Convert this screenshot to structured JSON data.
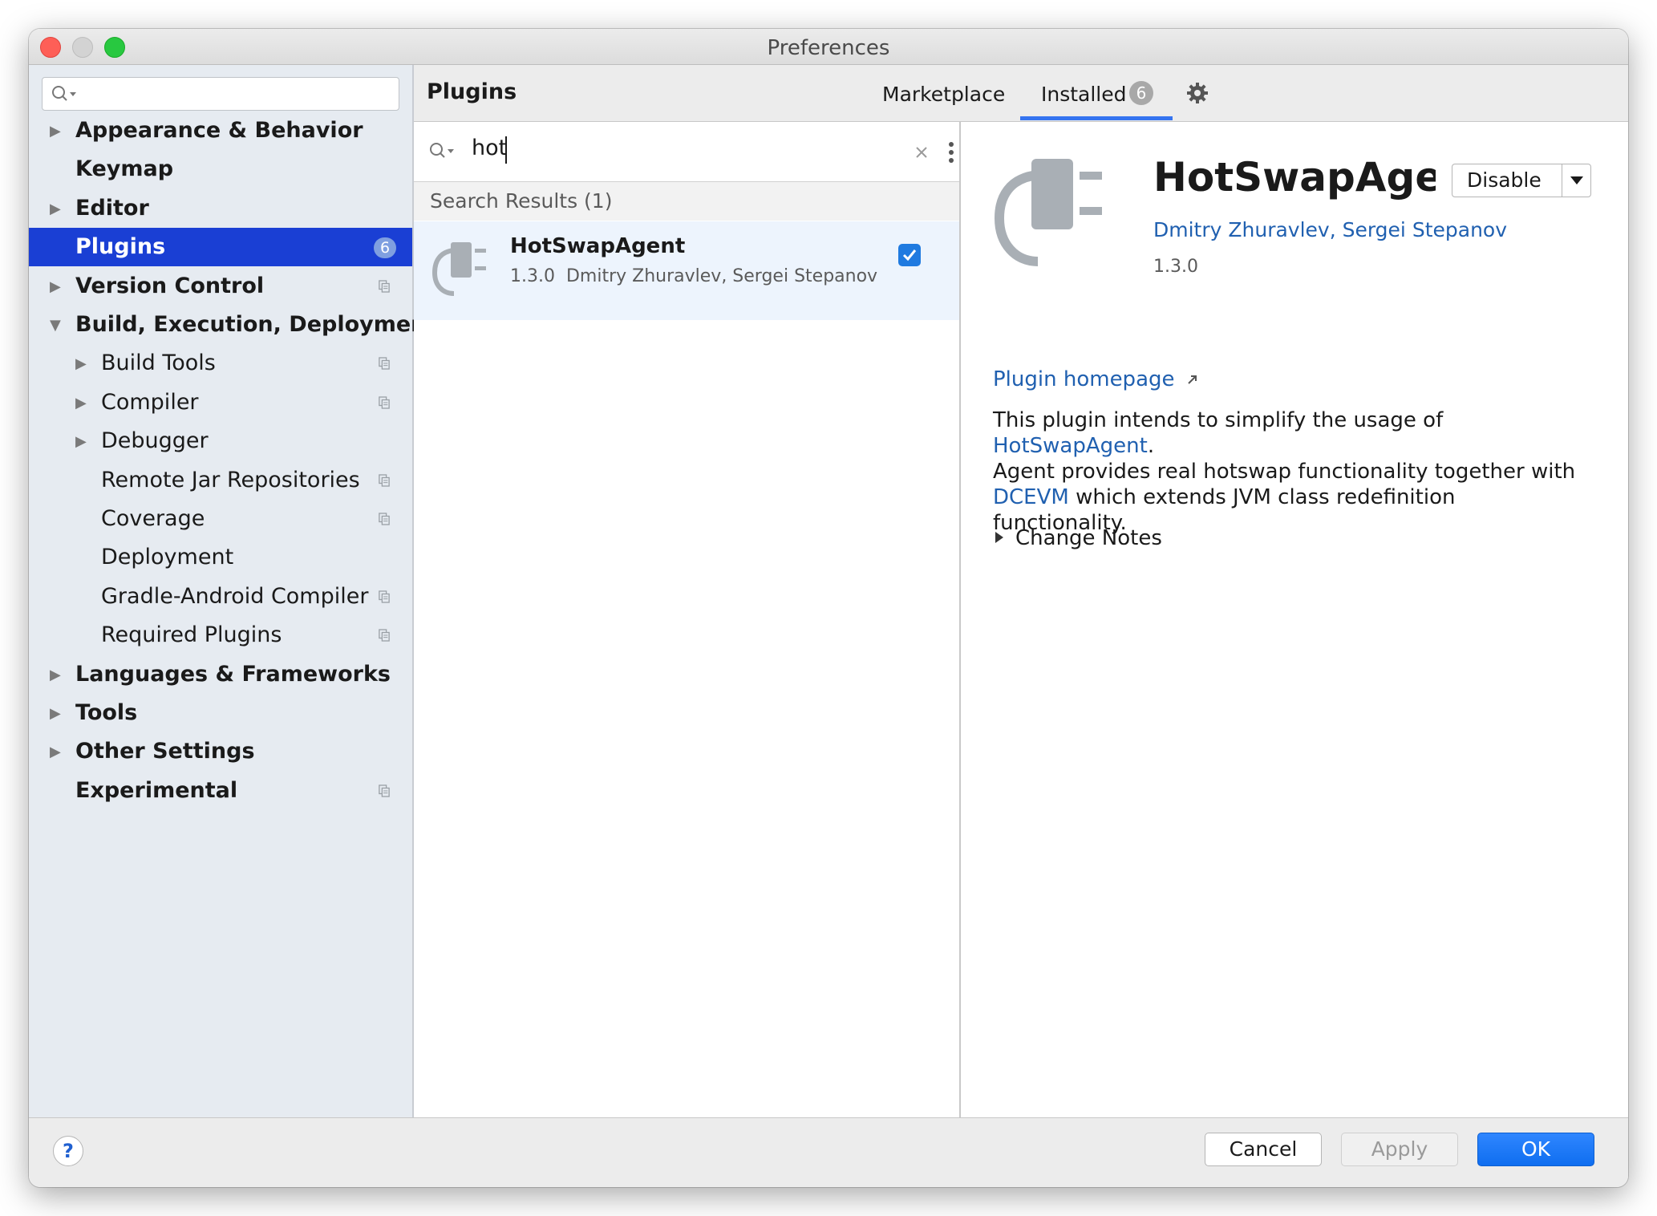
{
  "window": {
    "title": "Preferences",
    "traffic_colors": {
      "close": "#fe5f57",
      "minimize": "#d3d3d3",
      "zoom": "#28c840"
    }
  },
  "sidebar": {
    "search_placeholder": "",
    "items": [
      {
        "label": "Appearance & Behavior",
        "level": 0,
        "bold": true,
        "arrow": "collapsed",
        "project_icon": false
      },
      {
        "label": "Keymap",
        "level": 0,
        "bold": true,
        "arrow": "none",
        "project_icon": false
      },
      {
        "label": "Editor",
        "level": 0,
        "bold": true,
        "arrow": "collapsed",
        "project_icon": false
      },
      {
        "label": "Plugins",
        "level": 0,
        "bold": true,
        "arrow": "none",
        "selected": true,
        "badge": "6"
      },
      {
        "label": "Version Control",
        "level": 0,
        "bold": true,
        "arrow": "collapsed",
        "project_icon": true
      },
      {
        "label": "Build, Execution, Deployment",
        "level": 0,
        "bold": true,
        "arrow": "expanded",
        "project_icon": false
      },
      {
        "label": "Build Tools",
        "level": 1,
        "bold": false,
        "arrow": "collapsed",
        "project_icon": true
      },
      {
        "label": "Compiler",
        "level": 1,
        "bold": false,
        "arrow": "collapsed",
        "project_icon": true
      },
      {
        "label": "Debugger",
        "level": 1,
        "bold": false,
        "arrow": "collapsed",
        "project_icon": false
      },
      {
        "label": "Remote Jar Repositories",
        "level": 1,
        "bold": false,
        "arrow": "none",
        "project_icon": true
      },
      {
        "label": "Coverage",
        "level": 1,
        "bold": false,
        "arrow": "none",
        "project_icon": true
      },
      {
        "label": "Deployment",
        "level": 1,
        "bold": false,
        "arrow": "none",
        "project_icon": false
      },
      {
        "label": "Gradle-Android Compiler",
        "level": 1,
        "bold": false,
        "arrow": "none",
        "project_icon": true
      },
      {
        "label": "Required Plugins",
        "level": 1,
        "bold": false,
        "arrow": "none",
        "project_icon": true
      },
      {
        "label": "Languages & Frameworks",
        "level": 0,
        "bold": true,
        "arrow": "collapsed",
        "project_icon": false
      },
      {
        "label": "Tools",
        "level": 0,
        "bold": true,
        "arrow": "collapsed",
        "project_icon": false
      },
      {
        "label": "Other Settings",
        "level": 0,
        "bold": true,
        "arrow": "collapsed",
        "project_icon": false
      },
      {
        "label": "Experimental",
        "level": 0,
        "bold": true,
        "arrow": "none",
        "project_icon": true
      }
    ]
  },
  "plugins": {
    "title": "Plugins",
    "tabs": {
      "marketplace": "Marketplace",
      "installed": "Installed",
      "installed_count": "6"
    },
    "search_query": "hot",
    "results_header": "Search Results (1)",
    "results": [
      {
        "name": "HotSwapAgent",
        "version": "1.3.0",
        "authors": "Dmitry Zhuravlev, Sergei Stepanov",
        "enabled": true
      }
    ]
  },
  "detail": {
    "name": "HotSwapAgent",
    "authors": "Dmitry Zhuravlev, Sergei Stepanov",
    "version": "1.3.0",
    "disable_label": "Disable",
    "homepage_label": "Plugin homepage",
    "description": {
      "line1": "This plugin intends to simplify the usage of",
      "link1": "HotSwapAgent",
      "after_link1": ".",
      "line2": "Agent provides real hotswap functionality together with",
      "link2": "DCEVM",
      "after_link2": " which extends JVM class redefinition",
      "line3": "functionality."
    },
    "change_notes_label": "Change Notes"
  },
  "footer": {
    "help_label": "?",
    "cancel_label": "Cancel",
    "apply_label": "Apply",
    "ok_label": "OK"
  },
  "colors": {
    "selection": "#1a3fd4",
    "link": "#2060b0",
    "accent": "#3574f0"
  }
}
